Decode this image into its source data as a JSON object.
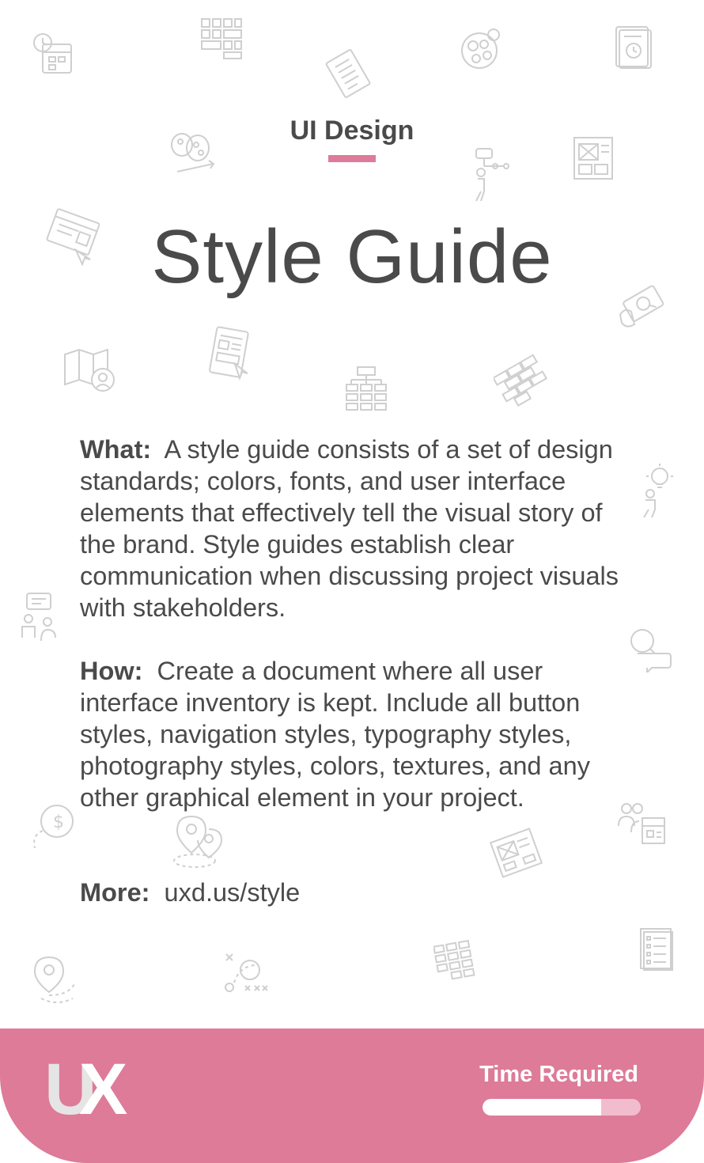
{
  "header": {
    "category": "UI Design",
    "title": "Style Guide"
  },
  "content": {
    "what_label": "What:",
    "what_text": "A style guide consists of a set of design standards; colors, fonts, and user interface elements that effectively tell the visual story of the brand. Style guides establish clear communication when discussing project visuals with stakeholders.",
    "how_label": "How:",
    "how_text": "Create a document where all user interface inventory is kept. Include all button styles, navigation styles, typography styles, photography styles, colors, textures, and any other graphical element in your project.",
    "more_label": "More:",
    "more_link": "uxd.us/style"
  },
  "footer": {
    "logo_u": "U",
    "logo_x": "X",
    "time_label": "Time Required",
    "time_required_fraction": 0.75
  },
  "colors": {
    "accent": "#dd7b98",
    "text": "#4a4a4a",
    "icon_gray": "#cfcfcf"
  },
  "icons": [
    "calendar-clock-icon",
    "grid-layout-icon",
    "checklist-icon",
    "gears-icon",
    "document-history-icon",
    "mood-board-icon",
    "user-flow-icon",
    "wireframe-icon",
    "browser-pointer-icon",
    "tablet-sketch-icon",
    "sitemap-icon",
    "brick-wall-icon",
    "map-search-icon",
    "idea-person-icon",
    "chat-people-icon",
    "search-chat-icon",
    "price-idea-icon",
    "user-location-icon",
    "wireframe-tilted-icon",
    "team-screen-icon",
    "location-pin-icon",
    "strategy-play-icon",
    "card-sort-icon",
    "list-document-icon"
  ]
}
